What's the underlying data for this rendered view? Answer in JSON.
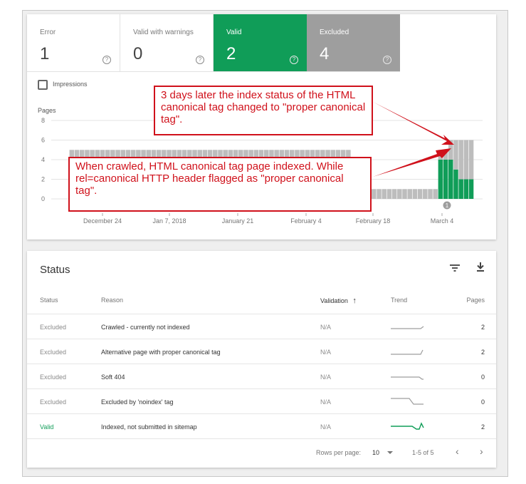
{
  "tiles": [
    {
      "label": "Error",
      "count": "1",
      "color": "#ffffff"
    },
    {
      "label": "Valid with warnings",
      "count": "0",
      "color": "#ffffff"
    },
    {
      "label": "Valid",
      "count": "2",
      "color": "#109d58"
    },
    {
      "label": "Excluded",
      "count": "4",
      "color": "#9e9e9e"
    }
  ],
  "help_glyph": "?",
  "impressions_label": "Impressions",
  "chart_data": {
    "type": "bar",
    "ylabel": "Pages",
    "ylim": [
      0,
      8
    ],
    "yticks": [
      "0",
      "2",
      "4",
      "6",
      "8"
    ],
    "xticks": [
      "December 24",
      "Jan 7, 2018",
      "January 21",
      "February 4",
      "February 18",
      "March 4"
    ],
    "series_colors": {
      "valid": "#109d58",
      "excluded": "#bdbdbd"
    },
    "series": [
      {
        "name": "Valid",
        "values": [
          0,
          0,
          0,
          2,
          2,
          2,
          2,
          2,
          2,
          2,
          2,
          2,
          2,
          2,
          2,
          2,
          2,
          2,
          2,
          2,
          2,
          2,
          2,
          2,
          2,
          2,
          2,
          2,
          2,
          2,
          2,
          2,
          2,
          2,
          2,
          2,
          2,
          2,
          2,
          2,
          2,
          2,
          2,
          2,
          2,
          2,
          2,
          2,
          2,
          2,
          2,
          2,
          2,
          2,
          2,
          2,
          2,
          2,
          0,
          0,
          0,
          0,
          0,
          0,
          0,
          0,
          0,
          0,
          0,
          0,
          0,
          0,
          0,
          0,
          0,
          4,
          4,
          4,
          3,
          2,
          2,
          2
        ]
      },
      {
        "name": "Excluded",
        "values": [
          0,
          0,
          0,
          3,
          3,
          3,
          3,
          3,
          3,
          3,
          3,
          3,
          3,
          3,
          3,
          3,
          3,
          3,
          3,
          3,
          3,
          3,
          3,
          3,
          3,
          3,
          3,
          3,
          3,
          3,
          3,
          3,
          3,
          3,
          3,
          3,
          3,
          3,
          3,
          3,
          3,
          3,
          3,
          3,
          3,
          3,
          3,
          3,
          3,
          3,
          3,
          3,
          3,
          3,
          3,
          3,
          3,
          3,
          1,
          1,
          1,
          1,
          1,
          1,
          1,
          1,
          1,
          1,
          1,
          1,
          1,
          1,
          1,
          1,
          1,
          1,
          1,
          2,
          3,
          4,
          4,
          4
        ]
      }
    ],
    "annotation_marker": "1"
  },
  "callouts": [
    "3 days later the index status of the HTML canonical tag changed to \"proper canonical tag\".",
    "When crawled, HTML canonical tag page indexed. While rel=canonical HTTP header flagged as \"proper canonical tag\"."
  ],
  "status": {
    "title": "Status",
    "columns": {
      "status": "Status",
      "reason": "Reason",
      "validation": "Validation",
      "trend": "Trend",
      "pages": "Pages"
    },
    "sort_arrow": "↑",
    "rows": [
      {
        "status": "Excluded",
        "reason": "Crawled - currently not indexed",
        "validation": "N/A",
        "pages": "2"
      },
      {
        "status": "Excluded",
        "reason": "Alternative page with proper canonical tag",
        "validation": "N/A",
        "pages": "2"
      },
      {
        "status": "Excluded",
        "reason": "Soft 404",
        "validation": "N/A",
        "pages": "0"
      },
      {
        "status": "Excluded",
        "reason": "Excluded by 'noindex' tag",
        "validation": "N/A",
        "pages": "0"
      },
      {
        "status": "Valid",
        "reason": "Indexed, not submitted in sitemap",
        "validation": "N/A",
        "pages": "2"
      }
    ],
    "valid_color": "#109d58",
    "footer": {
      "rows_per_page_label": "Rows per page:",
      "rows_per_page_value": "10",
      "range": "1-5 of 5",
      "prev": "‹",
      "next": "›"
    }
  }
}
